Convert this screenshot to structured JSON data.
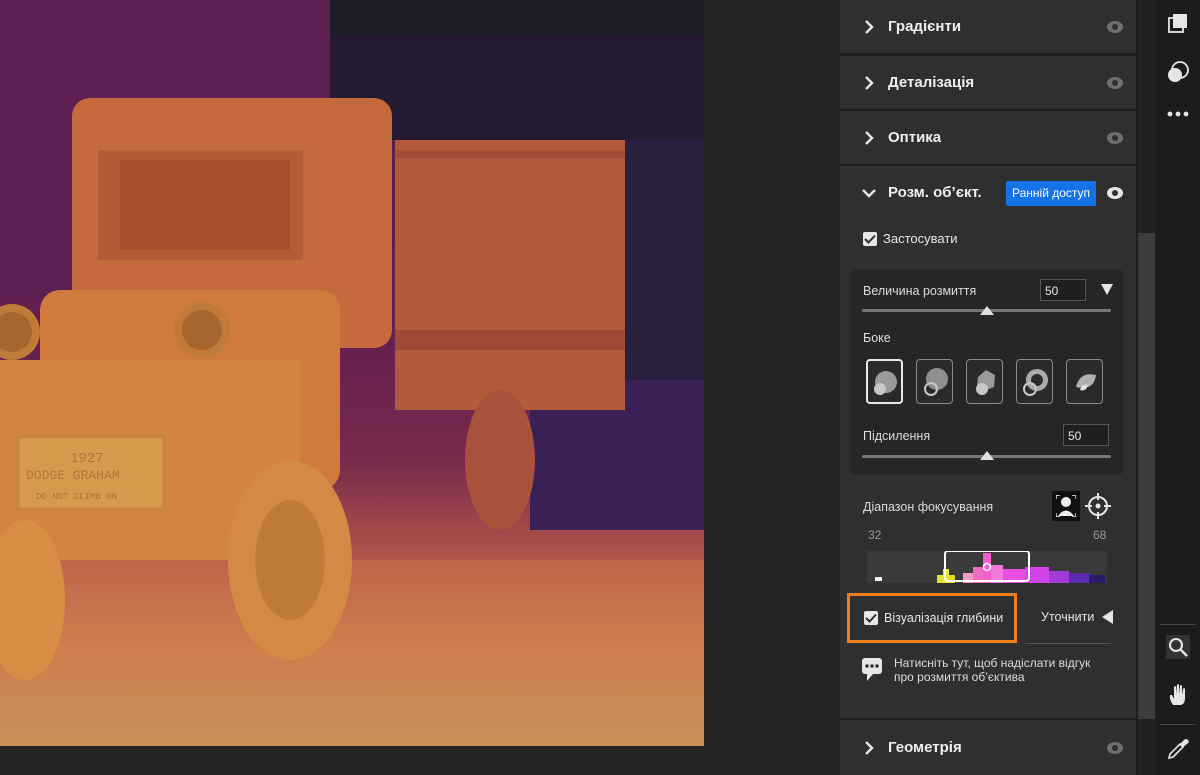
{
  "photo": {
    "plate_line1": "1927",
    "plate_line2": "DODGE GRAHAM",
    "plate_line3": "DO NOT CLIMB ON"
  },
  "panel": {
    "sections": {
      "gradients": "Градієнти",
      "detail": "Деталізація",
      "optics": "Оптика",
      "lens_blur": "Розм. об’єкт.",
      "geometry": "Геометрія"
    },
    "early_access": "Ранній доступ",
    "apply_label": "Застосувати",
    "blur_amount_label": "Величина розмиття",
    "blur_amount_value": "50",
    "blur_amount_level": 0.5,
    "bokeh_label": "Боке",
    "bokeh_selected": 0,
    "boost_label": "Підсилення",
    "boost_value": "50",
    "boost_level": 0.5,
    "focal_range_label": "Діапазон фокусування",
    "focal_min": "32",
    "focal_max": "68",
    "visualize_depth_label": "Візуалізація глибини",
    "refine_label": "Уточнити",
    "feedback_text_line1": "Натисніть тут, щоб надіслати відгук",
    "feedback_text_line2": "про розмиття об’єктива"
  },
  "colors": {
    "accent_blue": "#1473e6",
    "highlight_orange": "#f07f1e"
  },
  "icons": [
    "chevron-right-icon",
    "chevron-down-icon",
    "eye-icon",
    "checkbox-checked-icon",
    "dropdown-triangle-icon",
    "subject-focus-icon",
    "target-icon",
    "comment-icon",
    "triangle-left-icon",
    "layers-icon",
    "mask-icon",
    "more-icon",
    "zoom-icon",
    "hand-icon",
    "eyedropper-icon"
  ]
}
